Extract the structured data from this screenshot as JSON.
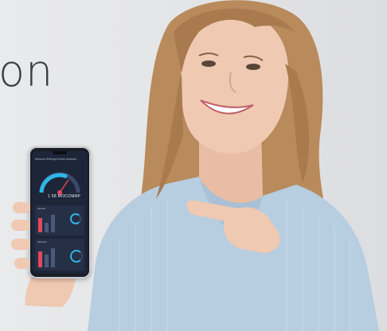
{
  "headline": "on",
  "phone": {
    "screen_title": "Network Settings  Device Analysis",
    "speed_readout": "1 58  MOCOMAP",
    "panel_1_label": "Internet",
    "panel_2_label": "Wireless"
  },
  "colors": {
    "background": "#e6e7e9",
    "headline": "#3a3f47",
    "shirt": "#b7cde0",
    "hair": "#b98a5c",
    "skin": "#efc9b2",
    "phone_screen": "#1d2538",
    "accent_red": "#e2495b",
    "accent_blue": "#2fb6e8"
  }
}
